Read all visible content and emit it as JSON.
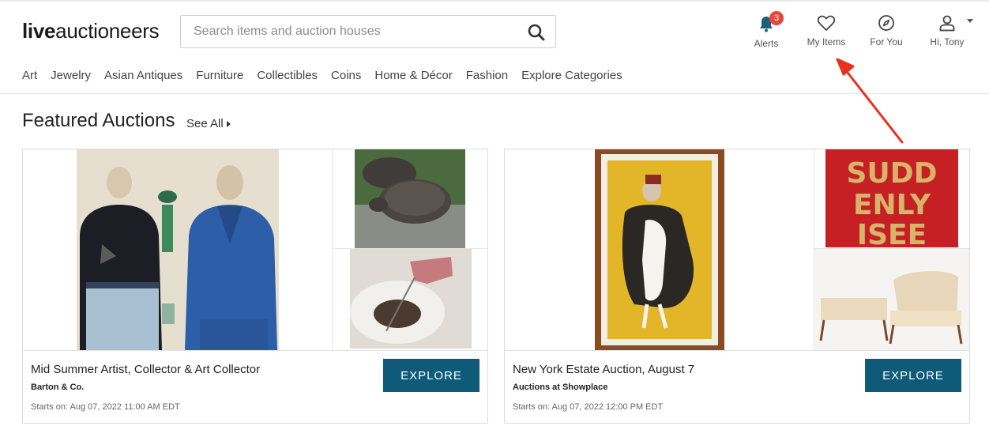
{
  "header": {
    "logo_live": "live",
    "logo_rest": "auctioneers",
    "search_placeholder": "Search items and auction houses",
    "alerts_label": "Alerts",
    "alerts_count": "3",
    "my_items_label": "My Items",
    "for_you_label": "For You",
    "account_label": "Hi, Tony"
  },
  "categories": [
    "Art",
    "Jewelry",
    "Asian Antiques",
    "Furniture",
    "Collectibles",
    "Coins",
    "Home & Décor",
    "Fashion",
    "Explore Categories"
  ],
  "featured": {
    "title": "Featured Auctions",
    "see_all": "See All"
  },
  "auctions": [
    {
      "title": "Mid Summer Artist, Collector & Art Collector",
      "house": "Barton & Co.",
      "starts": "Starts on: Aug 07, 2022 11:00 AM EDT",
      "button": "EXPLORE"
    },
    {
      "title": "New York Estate Auction, August 7",
      "house": "Auctions at Showplace",
      "starts": "Starts on: Aug 07, 2022 12:00 PM EDT",
      "button": "EXPLORE"
    }
  ],
  "artwork_text": "SUDD ENLY ISEE",
  "colors": {
    "button": "#0f5a78",
    "badge": "#e8473d",
    "annotation_arrow": "#e8321e"
  }
}
